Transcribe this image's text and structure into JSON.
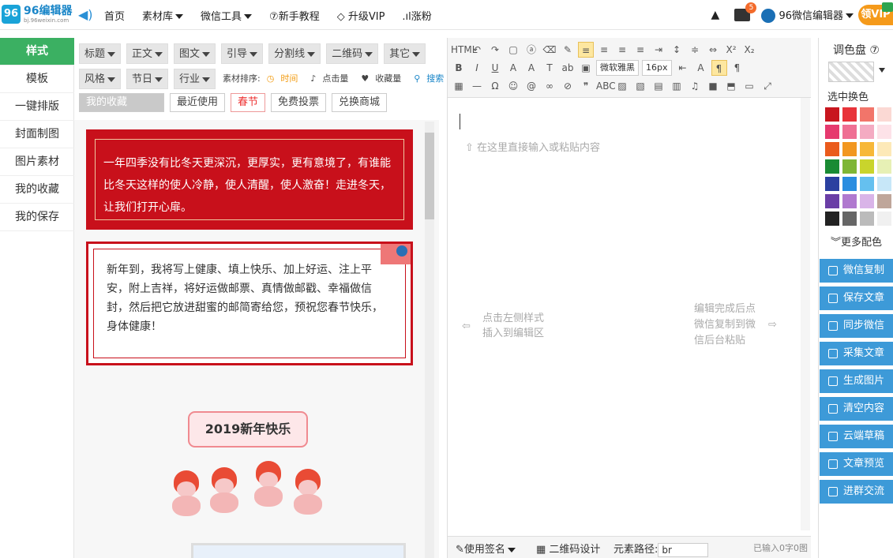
{
  "topbar": {
    "logo_title": "96编辑器",
    "logo_sub": "bj.96weixin.com",
    "nav": [
      {
        "label": "首页",
        "caret": false
      },
      {
        "label": "素材库",
        "caret": true
      },
      {
        "label": "微信工具",
        "caret": true
      },
      {
        "label": "⑦新手教程",
        "caret": false
      },
      {
        "label": "升级VIP",
        "caret": false
      },
      {
        "label": "涨粉",
        "caret": false
      }
    ],
    "message_count": "5",
    "user_name": "96微信编辑器",
    "vip_label": "领VIP"
  },
  "sidebar": {
    "items": [
      {
        "label": "样式",
        "active": true
      },
      {
        "label": "模板"
      },
      {
        "label": "一键排版"
      },
      {
        "label": "封面制图"
      },
      {
        "label": "图片素材"
      },
      {
        "label": "我的收藏"
      },
      {
        "label": "我的保存"
      }
    ]
  },
  "material": {
    "row1": [
      "标题",
      "正文",
      "图文",
      "引导",
      "分割线",
      "二维码",
      "其它"
    ],
    "row2": [
      "风格",
      "节日",
      "行业"
    ],
    "sort": {
      "label": "素材排序:",
      "time": "时间",
      "clicks": "点击量",
      "favorites": "收藏量",
      "search": "搜索"
    },
    "tags": [
      "我的收藏",
      "最近使用",
      "春节",
      "免费投票",
      "兑换商城"
    ],
    "card1_text": "一年四季没有比冬天更深沉，更厚实，更有意境了，有谁能比冬天这样的使人冷静，使人清醒，使人激奋！走进冬天，让我们打开心扉。",
    "card2_text": "新年到，我将写上健康、填上快乐、加上好运、注上平安，附上吉祥，将好运做邮票、真情做邮戳、幸福做信封，然后把它放进甜蜜的邮简寄给您，预祝您春节快乐，身体健康！",
    "ny_text": "2019新年快乐"
  },
  "editor": {
    "font_name": "微软雅黑",
    "font_size": "16px",
    "placeholder": "在这里直接输入或粘贴内容",
    "hint_left_1": "点击左侧样式",
    "hint_left_2": "插入到编辑区",
    "hint_right_1": "编辑完成后点",
    "hint_right_2": "微信复制到微",
    "hint_right_3": "信后台粘贴",
    "status": {
      "signature": "使用签名",
      "qr_design": "二维码设计",
      "path_label": "元素路径:",
      "path_value": "br",
      "count": "已输入0字0图"
    }
  },
  "palette": {
    "title": "调色盘 ⑦",
    "sub": "选中换色",
    "more": "更多配色",
    "colors": [
      "#c8161e",
      "#e8333a",
      "#f2756a",
      "#fbd9d4",
      "#e6396e",
      "#ef6f93",
      "#f4abc2",
      "#fde2e8",
      "#ea5b1c",
      "#f29720",
      "#f7b838",
      "#fde9b8",
      "#1a8b34",
      "#7fb636",
      "#c9d42c",
      "#e7f0b5",
      "#2b40a0",
      "#2a8de0",
      "#65c0ef",
      "#c7e7f8",
      "#6a3ea6",
      "#b079cf",
      "#d9b4e8",
      "#bfa69a",
      "#222222",
      "#666666",
      "#bbbbbb",
      "#f0f0f0"
    ],
    "actions": [
      "微信复制",
      "保存文章",
      "同步微信",
      "采集文章",
      "生成图片",
      "清空内容",
      "云端草稿",
      "文章预览",
      "进群交流"
    ]
  }
}
